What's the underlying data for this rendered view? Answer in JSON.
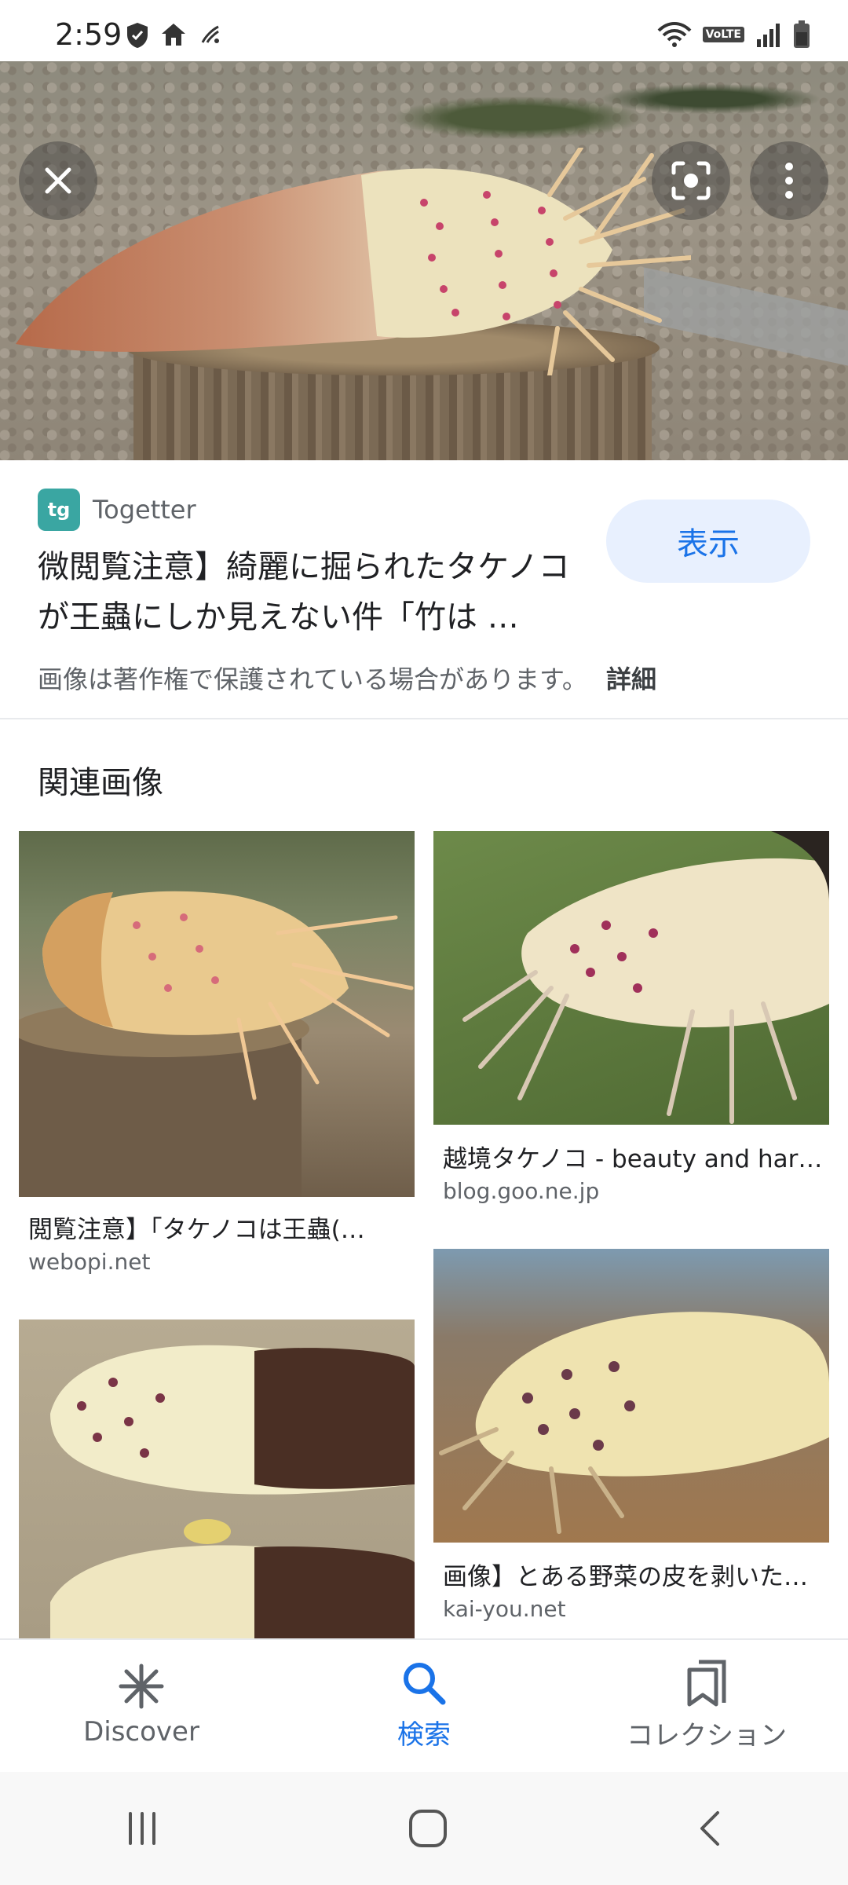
{
  "status_bar": {
    "time": "2:59",
    "volte": "VoLTE"
  },
  "hero": {
    "close_icon": "close-icon",
    "lens_icon": "lens-icon",
    "more_icon": "more-vert-icon"
  },
  "result": {
    "source_name": "Togetter",
    "source_logo_text": "tg",
    "title": "微閲覧注意】綺麗に掘られたタケノコが王蟲にしか見えない件「竹は …",
    "view_label": "表示",
    "copyright_text": "画像は著作権で保護されている場合があります。",
    "details_label": "詳細"
  },
  "related": {
    "heading": "関連画像",
    "items": [
      {
        "title": "閲覧注意】「タケノコは王蟲(…",
        "domain": "webopi.net"
      },
      {
        "title": "越境タケノコ - beauty and har…",
        "domain": "blog.goo.ne.jp"
      },
      {
        "title": "画像】とある野菜の皮を剥いた…",
        "domain": "kai-you.net"
      },
      {
        "title": "",
        "domain": ""
      }
    ]
  },
  "bottom_nav": {
    "items": [
      {
        "label": "Discover",
        "icon": "discover-asterisk-icon",
        "active": false
      },
      {
        "label": "検索",
        "icon": "search-icon",
        "active": true
      },
      {
        "label": "コレクション",
        "icon": "collections-icon",
        "active": false
      }
    ]
  },
  "colors": {
    "accent": "#1a73e8",
    "chip_bg": "#e8f0fe",
    "text_secondary": "#5f6368"
  }
}
